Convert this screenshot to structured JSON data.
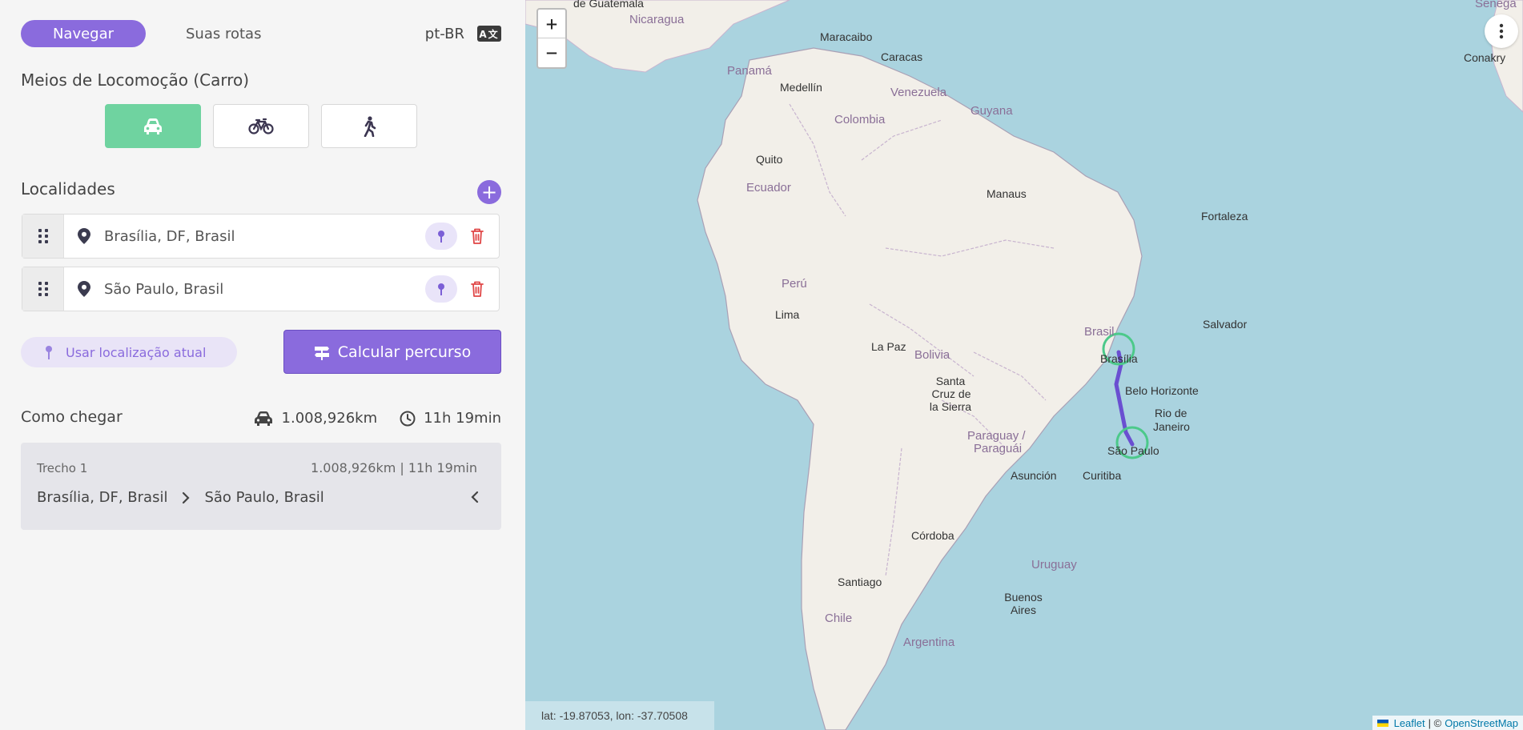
{
  "tabs": {
    "navigate": "Navegar",
    "routes": "Suas rotas"
  },
  "language": {
    "code": "pt-BR",
    "icon": "translate-icon"
  },
  "transport": {
    "title": "Meios de Locomoção (Carro)",
    "modes": [
      {
        "name": "car",
        "icon": "car-icon",
        "active": true
      },
      {
        "name": "bike",
        "icon": "bicycle-icon",
        "active": false
      },
      {
        "name": "walk",
        "icon": "walking-icon",
        "active": false
      }
    ],
    "active_color": "#6fd3a0"
  },
  "locations": {
    "title": "Localidades",
    "items": [
      {
        "value": "Brasília, DF, Brasil"
      },
      {
        "value": "São Paulo, Brasil"
      }
    ]
  },
  "actions": {
    "use_location": "Usar localização atual",
    "calculate": "Calcular percurso"
  },
  "directions": {
    "title": "Como chegar",
    "distance": "1.008,926km",
    "duration": "11h 19min",
    "legs": [
      {
        "label": "Trecho 1",
        "meta": "1.008,926km | 11h 19min",
        "from": "Brasília, DF, Brasil",
        "to": "São Paulo, Brasil"
      }
    ]
  },
  "map": {
    "zoom_in": "+",
    "zoom_out": "−",
    "coords": "lat: -19.87053, lon: -37.70508",
    "attribution": {
      "leaflet": "Leaflet",
      "sep": "| ©",
      "osm": "OpenStreetMap"
    },
    "labels": {
      "guatemala": "de Guatemala",
      "nicaragua": "Nicaragua",
      "panama": "Panamá",
      "maracaibo": "Maracaibo",
      "caracas": "Caracas",
      "medellin": "Medellín",
      "venezuela": "Venezuela",
      "colombia": "Colombia",
      "guyana": "Guyana",
      "quito": "Quito",
      "ecuador": "Ecuador",
      "manaus": "Manaus",
      "fortaleza": "Fortaleza",
      "peru": "Perú",
      "lima": "Lima",
      "lapaz": "La Paz",
      "bolivia": "Bolivia",
      "santa1": "Santa",
      "santa2": "Cruz de",
      "santa3": "la Sierra",
      "brasil": "Brasil",
      "brasilia": "Brasília",
      "salvador": "Salvador",
      "belo": "Belo Horizonte",
      "rio1": "Rio de",
      "rio2": "Janeiro",
      "saopaulo": "São Paulo",
      "paraguay1": "Paraguay /",
      "paraguay2": "Paraguái",
      "asuncion": "Asunción",
      "curitiba": "Curitiba",
      "cordoba": "Córdoba",
      "uruguay": "Uruguay",
      "santiago": "Santiago",
      "buenos1": "Buenos",
      "buenos2": "Aires",
      "chile": "Chile",
      "argentina": "Argentina",
      "senegal": "Senega",
      "conakry": "Conakry"
    },
    "route_color": "#6a4fd1",
    "marker_color": "#4cc98a"
  }
}
